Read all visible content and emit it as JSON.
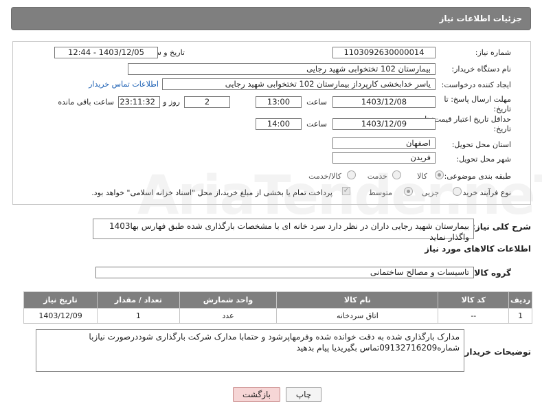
{
  "header": {
    "title": "جزئیات اطلاعات نیاز"
  },
  "fields": {
    "need_number_label": "شماره نیاز:",
    "need_number": "1103092630000014",
    "announce_label": "تاریخ و ساعت اعلان عمومی:",
    "announce_value": "1403/12/05 - 12:44",
    "buyer_org_label": "نام دستگاه خریدار:",
    "buyer_org": "بیمارستان 102 تختخوابی شهید رجایی",
    "requester_label": "ایجاد کننده درخواست:",
    "requester": "یاسر خدابخشی کارپرداز بیمارستان 102 تختخوابی شهید رجایی",
    "buyer_contact_link": "اطلاعات تماس خریدار",
    "reply_deadline_label_1": "مهلت ارسال پاسخ: تا",
    "reply_deadline_label_2": "تاریخ:",
    "reply_date": "1403/12/08",
    "time_label": "ساعت",
    "reply_time": "13:00",
    "days_value": "2",
    "days_label": "روز و",
    "remaining_time": "23:11:32",
    "remaining_label": "ساعت باقی مانده",
    "min_validity_label_1": "حداقل تاریخ اعتبار قیمت: تا",
    "min_validity_label_2": "تاریخ:",
    "validity_date": "1403/12/09",
    "validity_time": "14:00",
    "province_label": "استان محل تحویل:",
    "province": "اصفهان",
    "city_label": "شهر محل تحویل:",
    "city": "فریدن",
    "category_label": "طبقه بندی موضوعی:",
    "category_options": [
      "کالا",
      "خدمت",
      "کالا/خدمت"
    ],
    "process_label": "نوع فرآیند خرید :",
    "process_options": [
      "جزیی",
      "متوسط"
    ],
    "payment_note": "پرداخت تمام یا بخشی از مبلغ خرید،از محل \"اسناد خزانه اسلامی\" خواهد بود."
  },
  "summary": {
    "label": "شرح کلی نیاز:",
    "line1": "بیمارستان شهید رجایی داران در نظر دارد سرد خانه ای با مشخصات بارگذاری شده طبق فهارس بها1403",
    "line2": "واگذار نماید"
  },
  "goods_info": {
    "title": "اطلاعات کالاهای مورد نیاز",
    "group_label": "گروه کالا:",
    "group_value": "تاسیسات و مصالح ساختمانی"
  },
  "table": {
    "headers": [
      "ردیف",
      "کد کالا",
      "نام کالا",
      "واحد شمارش",
      "تعداد / مقدار",
      "تاریخ نیاز"
    ],
    "rows": [
      [
        "1",
        "--",
        "اتاق سردخانه",
        "عدد",
        "1",
        "1403/12/09"
      ]
    ]
  },
  "buyer_notes": {
    "label": "توضیحات خریدار:",
    "line1": "مدارک بارگذاری شده به دقت خوانده شده وفرمهاپرشود و حتمابا مدارک شرکت بارگذاری شوددرصورت نیازبا",
    "line2": "شماره09132716209تماس بگیریدیا پیام بدهید"
  },
  "buttons": {
    "print": "چاپ",
    "back": "بازگشت"
  },
  "watermark": "AriaTender.neT"
}
